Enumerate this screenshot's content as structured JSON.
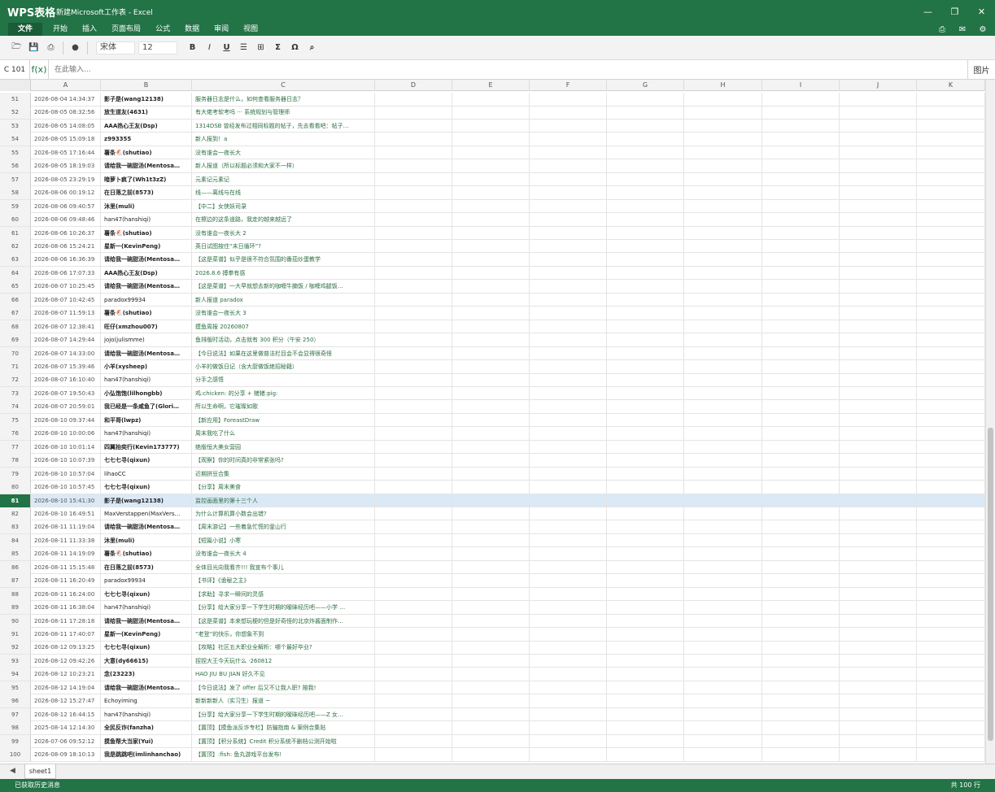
{
  "app": {
    "brand": "WPS表格",
    "doc_title": "新建Microsoft工作表 - Excel",
    "window_buttons": [
      "minimize-icon",
      "restore-icon",
      "close-icon"
    ]
  },
  "menu": {
    "items": [
      "文件",
      "开始",
      "插入",
      "页面布局",
      "公式",
      "数据",
      "审阅",
      "视图"
    ],
    "active": "文件",
    "right_icons": [
      "print-icon",
      "mail-icon",
      "gear-icon"
    ]
  },
  "toolbar": {
    "icons": [
      "open-folder-icon",
      "save-icon",
      "print-icon",
      "record-icon"
    ],
    "font_name": "宋体",
    "font_size": "12",
    "format_buttons": {
      "bold": "B",
      "italic": "I",
      "underline": "U",
      "align": "☰",
      "border": "⊞",
      "sum": "Σ",
      "symbol": "Ω",
      "search": "⌕"
    }
  },
  "formula_bar": {
    "cell_ref": "C 101",
    "fx": "f(x)",
    "placeholder": "在此输入...",
    "right_button": "图片"
  },
  "columns": [
    "A",
    "B",
    "C",
    "D",
    "E",
    "F",
    "G",
    "H",
    "I",
    "J",
    "K"
  ],
  "selected_row": 81,
  "rows": [
    {
      "n": 51,
      "a": "2026-08-04 14:34:37",
      "b": "影子是(wang12138)",
      "c": "服务器日志是什么，如何查看服务器日志？",
      "bold": true
    },
    {
      "n": 52,
      "a": "2026-08-05 08:32:56",
      "b": "放生道友(4631)",
      "c": "有大佬考软考吗 ··· 系统规划与管理师",
      "bold": true
    },
    {
      "n": 53,
      "a": "2026-08-05 14:08:05",
      "b": "AAA热心王友(Dsp)",
      "c": "1314DSB 曾经发布过相同标题的帖子，先去看看吧：帖子…",
      "bold": true
    },
    {
      "n": 54,
      "a": "2026-08-05 15:09:18",
      "b": "z993355",
      "c": "新人报到！a",
      "bold": true
    },
    {
      "n": 55,
      "a": "2026-08-05 17:16:44",
      "b": "薯条🐔(shutiao)",
      "c": "没有谁会一夜长大",
      "bold": true
    },
    {
      "n": 56,
      "a": "2026-08-05 18:19:03",
      "b": "请给我一碗甜汤(Mentosa…",
      "c": "新人报道（所以标题必须和大家不一样）",
      "bold": true
    },
    {
      "n": 57,
      "a": "2026-08-05 23:29:19",
      "b": "暗萝卜疯了(Wh1t3zZ)",
      "c": "元素记元素记",
      "bold": true
    },
    {
      "n": 58,
      "a": "2026-08-06 00:19:12",
      "b": "在日落之前(8573)",
      "c": "线——离线与在线",
      "bold": true
    },
    {
      "n": 59,
      "a": "2026-08-06 09:40:57",
      "b": "沐里(muli)",
      "c": "【中二】女侠妖司录",
      "bold": true
    },
    {
      "n": 60,
      "a": "2026-08-06 09:48:46",
      "b": "han47(hanshiqi)",
      "c": "在擦边的这条道路，我走的越来越远了",
      "bold": false
    },
    {
      "n": 61,
      "a": "2026-08-06 10:26:37",
      "b": "薯条🐔(shutiao)",
      "c": "没有谁会一夜长大 2",
      "bold": true
    },
    {
      "n": 62,
      "a": "2026-08-06 15:24:21",
      "b": "星新一(KevinPeng)",
      "c": "英日试图按住“末日循环”?",
      "bold": true
    },
    {
      "n": 63,
      "a": "2026-08-06 16:36:39",
      "b": "请给我一碗甜汤(Mentosa…",
      "c": "【这是菜谱】似乎是很不符合氛围的番茄炒蛋教学",
      "bold": true
    },
    {
      "n": 64,
      "a": "2026-08-06 17:07:33",
      "b": "AAA热心王友(Dsp)",
      "c": "2026.8.6 搏拳有感",
      "bold": true
    },
    {
      "n": 65,
      "a": "2026-08-07 10:25:45",
      "b": "请给我一碗甜汤(Mentosa…",
      "c": "【这是菜谱】一大早就想去新的咖喱牛腩饭 / 咖喱鸡腿饭…",
      "bold": true
    },
    {
      "n": 66,
      "a": "2026-08-07 10:42:45",
      "b": "paradox99934",
      "c": "新人报道 paradox",
      "bold": false
    },
    {
      "n": 67,
      "a": "2026-08-07 11:59:13",
      "b": "薯条🐔(shutiao)",
      "c": "没有谁会一夜长大 3",
      "bold": true
    },
    {
      "n": 68,
      "a": "2026-08-07 12:38:41",
      "b": "旺仔(xmzhou007)",
      "c": "摸鱼周报 20260807",
      "bold": true
    },
    {
      "n": 69,
      "a": "2026-08-07 14:29:44",
      "b": "jojo(julismme)",
      "c": "鱼排版时活动，点击就有 300 积分（午安 250）",
      "bold": false
    },
    {
      "n": 70,
      "a": "2026-08-07 14:33:00",
      "b": "请给我一碗甜汤(Mentosa…",
      "c": "【今日说法】如果在这里做普法栏目会不会显得很奇怪",
      "bold": true
    },
    {
      "n": 71,
      "a": "2026-08-07 15:39:46",
      "b": "小羊(xysheep)",
      "c": "小羊的做饭日记（含大厨做饭绝招秘籍）",
      "bold": true
    },
    {
      "n": 72,
      "a": "2026-08-07 16:10:40",
      "b": "han47(hanshiqi)",
      "c": "分手之感悟",
      "bold": false
    },
    {
      "n": 73,
      "a": "2026-08-07 19:50:43",
      "b": "小弘饱饱(lilhongbb)",
      "c": "鸡:chicken: 的分享 + 猪猪:pig:",
      "bold": true
    },
    {
      "n": 74,
      "a": "2026-08-07 20:59:01",
      "b": "我已经是一条咸鱼了(Glori…",
      "c": "所以生命啊，它璀璨如歌",
      "bold": true
    },
    {
      "n": 75,
      "a": "2026-08-10 09:37:44",
      "b": "和平哥(lwpz)",
      "c": "【新应用】ForeastDraw",
      "bold": true
    },
    {
      "n": 76,
      "a": "2026-08-10 10:00:06",
      "b": "han47(hanshiqi)",
      "c": "周末我吃了什么",
      "bold": false
    },
    {
      "n": 77,
      "a": "2026-08-10 10:01:14",
      "b": "四翼抬奕行(Kevin173777)",
      "c": "绝版恒大美女营园",
      "bold": true
    },
    {
      "n": 78,
      "a": "2026-08-10 10:07:39",
      "b": "七七七寻(qixun)",
      "c": "【观察】你的时间真的非常紧张吗?",
      "bold": true
    },
    {
      "n": 79,
      "a": "2026-08-10 10:57:04",
      "b": "lihaoCC",
      "c": "近期拼豆合集",
      "bold": false
    },
    {
      "n": 80,
      "a": "2026-08-10 10:57:45",
      "b": "七七七寻(qixun)",
      "c": "【分享】周末美食",
      "bold": true
    },
    {
      "n": 81,
      "a": "2026-08-10 15:41:30",
      "b": "影子是(wang12138)",
      "c": "监控画面里的第十三个人",
      "bold": true
    },
    {
      "n": 82,
      "a": "2026-08-10 16:49:51",
      "b": "MaxVerstappen(MaxVers…",
      "c": "为什么计算机算小数会出错?",
      "bold": false
    },
    {
      "n": 83,
      "a": "2026-08-11 11:19:04",
      "b": "请给我一碗甜汤(Mentosa…",
      "c": "【周末游记】一些着急忙慌的釜山行",
      "bold": true
    },
    {
      "n": 84,
      "a": "2026-08-11 11:33:38",
      "b": "沐里(muli)",
      "c": "【短篇小说】小寒",
      "bold": true
    },
    {
      "n": 85,
      "a": "2026-08-11 14:19:09",
      "b": "薯条🐔(shutiao)",
      "c": "没有谁会一夜长大 4",
      "bold": true
    },
    {
      "n": 86,
      "a": "2026-08-11 15:15:48",
      "b": "在日落之前(8573)",
      "c": "全体目光向我看齐!!! 我宣布个事儿",
      "bold": true
    },
    {
      "n": 87,
      "a": "2026-08-11 16:20:49",
      "b": "paradox99934",
      "c": "【书评】《诡秘之主》",
      "bold": false
    },
    {
      "n": 88,
      "a": "2026-08-11 16:24:00",
      "b": "七七七寻(qixun)",
      "c": "【求助】寻求一瞬间的灵感",
      "bold": true
    },
    {
      "n": 89,
      "a": "2026-08-11 16:38:04",
      "b": "han47(hanshiqi)",
      "c": "【分享】给大家分享一下学生时期的暧昧经历吧——小学 …",
      "bold": false
    },
    {
      "n": 90,
      "a": "2026-08-11 17:28:18",
      "b": "请给我一碗甜汤(Mentosa…",
      "c": "【这是菜谱】本来想玩梗的但是好奇怪的北京炸酱面制作…",
      "bold": true
    },
    {
      "n": 91,
      "a": "2026-08-11 17:40:07",
      "b": "星新一(KevinPeng)",
      "c": "“老登”的快乐，你想象不到",
      "bold": true
    },
    {
      "n": 92,
      "a": "2026-08-12 09:13:25",
      "b": "七七七寻(qixun)",
      "c": "【攻略】社区五大职业全解析：哪个最好毕业?",
      "bold": true
    },
    {
      "n": 93,
      "a": "2026-08-12 09:42:26",
      "b": "大意(dy66615)",
      "c": "捏捏大王今天玩什么 ·260812",
      "bold": true
    },
    {
      "n": 94,
      "a": "2026-08-12 10:23:21",
      "b": "念(23223)",
      "c": "HAO JIU BU JIAN 好久不见",
      "bold": true
    },
    {
      "n": 95,
      "a": "2026-08-12 14:19:04",
      "b": "请给我一碗甜汤(Mentosa…",
      "c": "【今日说法】发了 offer 后又不让我入职? 赔我!",
      "bold": true
    },
    {
      "n": 96,
      "a": "2026-08-12 15:27:47",
      "b": "Echoyiming",
      "c": "新新新新人（实习生）报道 ~",
      "bold": false
    },
    {
      "n": 97,
      "a": "2026-08-12 16:44:15",
      "b": "han47(hanshiqi)",
      "c": "【分享】给大家分享一下学生时期的暧昧经历吧——Z 女…",
      "bold": false
    },
    {
      "n": 98,
      "a": "2025-08-14 12:14:30",
      "b": "全民反诈(fanzha)",
      "c": "【置顶】【摸鱼派反诈专栏】防骗指南 & 案例合集贴",
      "bold": true
    },
    {
      "n": 99,
      "a": "2026-07-06 09:52:12",
      "b": "摸鱼帮大当家(Yui)",
      "c": "【置顶】【积分系统】Credit 积分系统不删档公测开始啦",
      "bold": true
    },
    {
      "n": 100,
      "a": "2026-08-09 18:10:13",
      "b": "我是跳跳吧(imlinhanchao)",
      "c": "【置顶】:fish: 鱼丸游戏平台发布!",
      "bold": true
    }
  ],
  "sheet": {
    "nav": "◀",
    "tab": "sheet1"
  },
  "status": {
    "left": "已获取历史消息",
    "right": "共 100 行"
  }
}
